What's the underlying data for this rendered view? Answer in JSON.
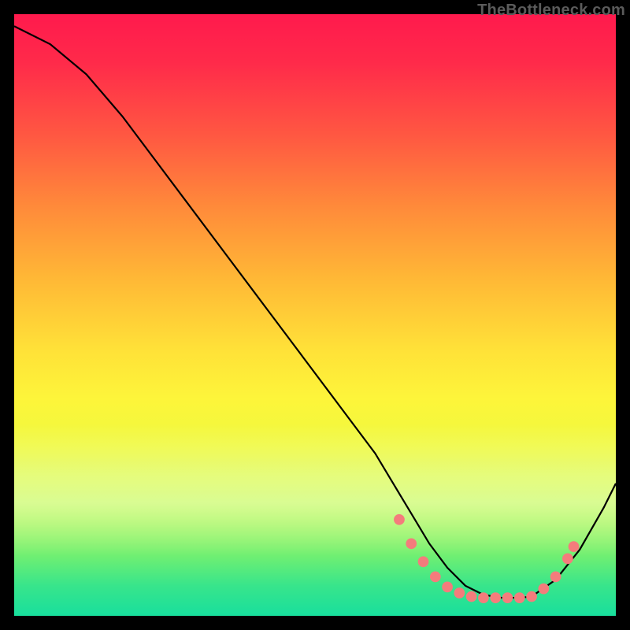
{
  "attribution": "TheBottleneck.com",
  "chart_data": {
    "type": "line",
    "title": "",
    "xlabel": "",
    "ylabel": "",
    "xlim": [
      0,
      100
    ],
    "ylim": [
      0,
      100
    ],
    "series": [
      {
        "name": "curve",
        "x": [
          0,
          6,
          12,
          18,
          24,
          30,
          36,
          42,
          48,
          54,
          60,
          63,
          66,
          69,
          72,
          75,
          78,
          81,
          84,
          86,
          90,
          94,
          98,
          100
        ],
        "values": [
          98,
          95,
          90,
          83,
          75,
          67,
          59,
          51,
          43,
          35,
          27,
          22,
          17,
          12,
          8,
          5,
          3.5,
          3,
          3,
          3.2,
          6,
          11,
          18,
          22
        ]
      }
    ],
    "markers": {
      "comment": "salmon dots along the valley",
      "points": [
        {
          "x": 64,
          "y": 16
        },
        {
          "x": 66,
          "y": 12
        },
        {
          "x": 68,
          "y": 9
        },
        {
          "x": 70,
          "y": 6.5
        },
        {
          "x": 72,
          "y": 4.8
        },
        {
          "x": 74,
          "y": 3.8
        },
        {
          "x": 76,
          "y": 3.2
        },
        {
          "x": 78,
          "y": 3.0
        },
        {
          "x": 80,
          "y": 3.0
        },
        {
          "x": 82,
          "y": 3.0
        },
        {
          "x": 84,
          "y": 3.0
        },
        {
          "x": 86,
          "y": 3.2
        },
        {
          "x": 88,
          "y": 4.5
        },
        {
          "x": 90,
          "y": 6.5
        },
        {
          "x": 92,
          "y": 9.5
        },
        {
          "x": 93,
          "y": 11.5
        }
      ]
    },
    "background_gradient": {
      "top": "#ff1a4d",
      "mid": "#ffe238",
      "bottom": "#18df9d"
    }
  }
}
